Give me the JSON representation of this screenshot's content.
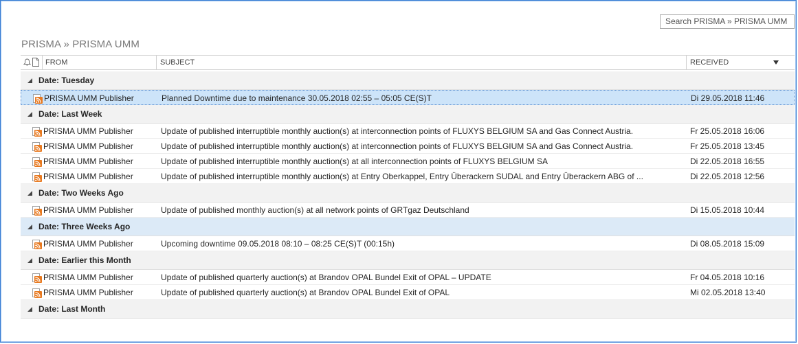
{
  "search": {
    "placeholder": "Search PRISMA » PRISMA UMM"
  },
  "folder": {
    "title": "PRISMA » PRISMA UMM"
  },
  "columns": {
    "from": "FROM",
    "subject": "SUBJECT",
    "received": "RECEIVED"
  },
  "colors": {
    "selected_row": "#cde4f9",
    "group_header": "#f2f2f2",
    "rss_orange": "#e8791f"
  },
  "groups": [
    {
      "label": "Date: Tuesday",
      "highlight": false,
      "rows": [
        {
          "from": "PRISMA UMM Publisher",
          "subject": "Planned Downtime due to maintenance 30.05.2018 02:55 – 05:05 CE(S)T",
          "received": "Di 29.05.2018 11:46",
          "selected": true
        }
      ]
    },
    {
      "label": "Date: Last Week",
      "highlight": false,
      "rows": [
        {
          "from": "PRISMA UMM Publisher",
          "subject": "Update of published interruptible monthly auction(s) at  interconnection points of FLUXYS BELGIUM SA and Gas Connect Austria.",
          "received": "Fr 25.05.2018 16:06",
          "selected": false
        },
        {
          "from": "PRISMA UMM Publisher",
          "subject": "Update of published interruptible monthly auction(s) at  interconnection points of FLUXYS BELGIUM SA and Gas Connect Austria.",
          "received": "Fr 25.05.2018 13:45",
          "selected": false
        },
        {
          "from": "PRISMA UMM Publisher",
          "subject": "Update of published interruptible monthly auction(s) at all interconnection points of FLUXYS BELGIUM SA",
          "received": "Di 22.05.2018 16:55",
          "selected": false
        },
        {
          "from": "PRISMA UMM Publisher",
          "subject": "Update of published interruptible monthly auction(s) at Entry Oberkappel, Entry Überackern SUDAL and Entry Überackern ABG of ...",
          "received": "Di 22.05.2018 12:56",
          "selected": false
        }
      ]
    },
    {
      "label": "Date: Two Weeks Ago",
      "highlight": false,
      "rows": [
        {
          "from": "PRISMA UMM Publisher",
          "subject": "Update of published monthly auction(s) at all network points of GRTgaz Deutschland",
          "received": "Di 15.05.2018 10:44",
          "selected": false
        }
      ]
    },
    {
      "label": "Date: Three Weeks Ago",
      "highlight": true,
      "rows": [
        {
          "from": "PRISMA UMM Publisher",
          "subject": "Upcoming downtime 09.05.2018 08:10 – 08:25 CE(S)T (00:15h)",
          "received": "Di 08.05.2018 15:09",
          "selected": false
        }
      ]
    },
    {
      "label": "Date: Earlier this Month",
      "highlight": false,
      "rows": [
        {
          "from": "PRISMA UMM Publisher",
          "subject": "Update of published quarterly auction(s) at Brandov OPAL Bundel Exit of OPAL – UPDATE",
          "received": "Fr 04.05.2018 10:16",
          "selected": false
        },
        {
          "from": "PRISMA UMM Publisher",
          "subject": "Update of published quarterly auction(s) at Brandov OPAL Bundel Exit of OPAL",
          "received": "Mi 02.05.2018 13:40",
          "selected": false
        }
      ]
    },
    {
      "label": "Date: Last Month",
      "highlight": false,
      "rows": []
    }
  ]
}
